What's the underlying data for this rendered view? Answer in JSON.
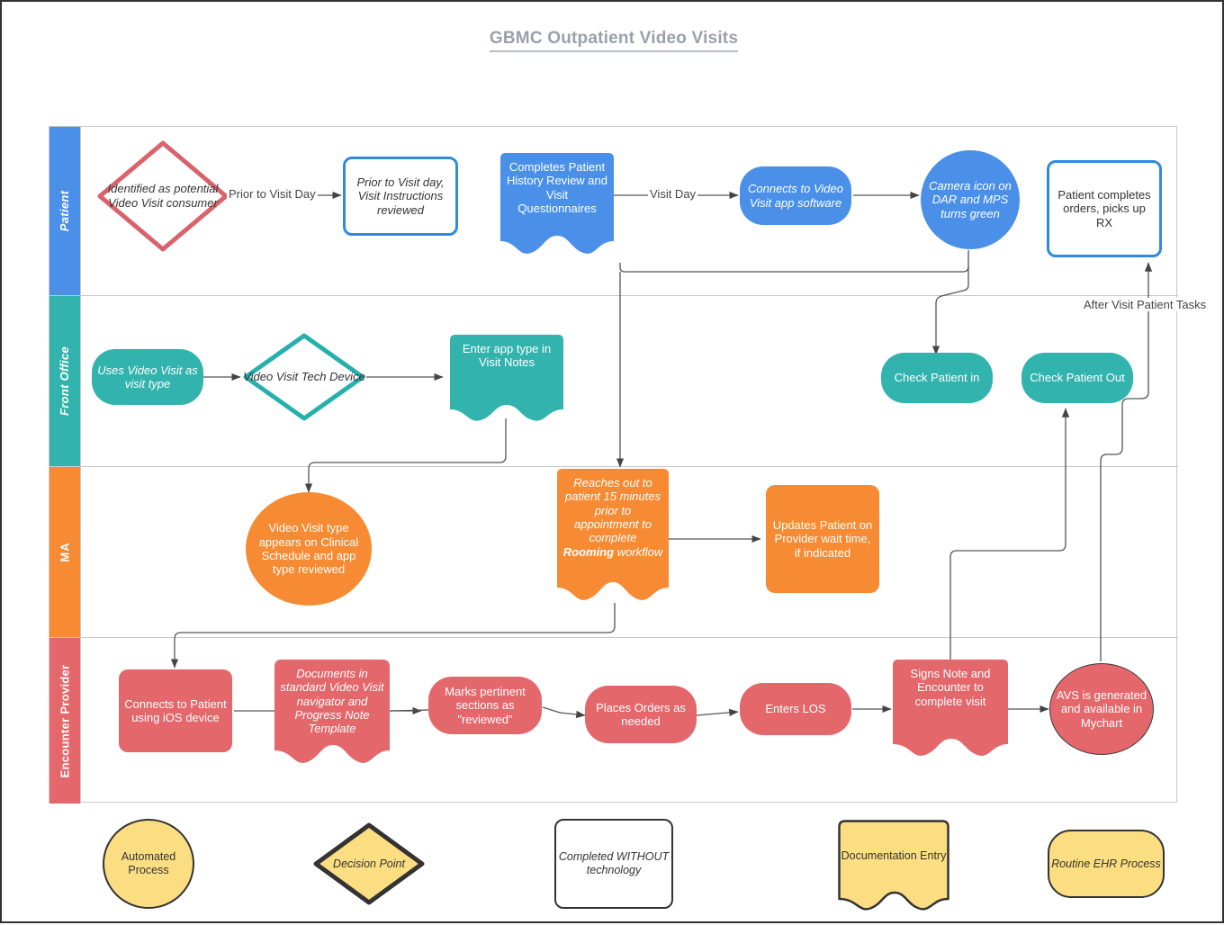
{
  "title": "GBMC Outpatient Video Visits",
  "lanes": [
    {
      "id": "patient",
      "label": "Patient",
      "color": "#4a90e8"
    },
    {
      "id": "front_office",
      "label": "Front Office",
      "color": "#32b3ad"
    },
    {
      "id": "ma",
      "label": "MA",
      "color": "#f68b33"
    },
    {
      "id": "provider",
      "label": "Encounter Provider",
      "color": "#e4676b"
    }
  ],
  "nodes": {
    "patient": [
      {
        "id": "identified",
        "text": "Identified as potential Video Visit consumer",
        "shape": "decision",
        "style": "outline",
        "color": "#d9636b"
      },
      {
        "id": "instructions",
        "text": "Prior to Visit day, Visit Instructions reviewed",
        "shape": "rounded-rect",
        "style": "outline",
        "color": "#2f8ae0"
      },
      {
        "id": "completes_history",
        "text": "Completes Patient History Review and Visit Questionnaires",
        "shape": "document",
        "style": "filled",
        "color": "#4a90e8"
      },
      {
        "id": "connects_app",
        "text": "Connects to Video Visit app software",
        "shape": "pill",
        "style": "filled",
        "color": "#4a90e8"
      },
      {
        "id": "camera_icon",
        "text": "Camera icon on DAR and MPS turns green",
        "shape": "ellipse",
        "style": "filled",
        "color": "#4a90e8"
      },
      {
        "id": "patient_completes_orders",
        "text": "Patient completes orders, picks up RX",
        "shape": "rounded-rect",
        "style": "outline",
        "color": "#2f8ae0"
      }
    ],
    "front_office": [
      {
        "id": "uses_video_visit",
        "text": "Uses Video Visit as visit type",
        "shape": "pill",
        "style": "filled",
        "color": "#32b3ad"
      },
      {
        "id": "tech_device",
        "text": "Video Visit Tech Device",
        "shape": "decision",
        "style": "outline",
        "color": "#26b0ad"
      },
      {
        "id": "enter_app_type",
        "text": "Enter app type in Visit Notes",
        "shape": "document",
        "style": "filled",
        "color": "#32b3ad"
      },
      {
        "id": "check_in",
        "text": "Check Patient in",
        "shape": "pill",
        "style": "filled",
        "color": "#32b3ad"
      },
      {
        "id": "check_out",
        "text": "Check Patient Out",
        "shape": "pill",
        "style": "filled",
        "color": "#32b3ad"
      }
    ],
    "ma": [
      {
        "id": "type_appears",
        "text": "Video Visit type appears on Clinical Schedule and app type reviewed",
        "shape": "ellipse",
        "style": "filled",
        "color": "#f68b33"
      },
      {
        "id": "reaches_out",
        "text": "Reaches out to patient 15 minutes prior to appointment to complete Rooming workflow",
        "bold_word": "Rooming",
        "shape": "document",
        "style": "filled",
        "color": "#f68b33"
      },
      {
        "id": "updates_wait",
        "text": "Updates Patient on Provider wait time, if indicated",
        "shape": "rounded-rect",
        "style": "filled",
        "color": "#f68b33"
      }
    ],
    "provider": [
      {
        "id": "connects_ios",
        "text": "Connects to Patient using iOS device",
        "shape": "rounded-rect",
        "style": "filled",
        "color": "#e4676b"
      },
      {
        "id": "documents_nav",
        "text": "Documents in standard Video Visit navigator and Progress Note Template",
        "shape": "document",
        "style": "filled",
        "color": "#e4676b"
      },
      {
        "id": "marks_reviewed",
        "text": "Marks pertinent sections as \"reviewed\"",
        "shape": "pill",
        "style": "filled",
        "color": "#e4676b"
      },
      {
        "id": "places_orders",
        "text": "Places Orders as needed",
        "shape": "pill",
        "style": "filled",
        "color": "#e4676b"
      },
      {
        "id": "enters_los",
        "text": "Enters LOS",
        "shape": "pill",
        "style": "filled",
        "color": "#e4676b"
      },
      {
        "id": "signs_note",
        "text": "Signs Note and Encounter to complete visit",
        "shape": "document",
        "style": "filled",
        "color": "#e4676b"
      },
      {
        "id": "avs",
        "text": "AVS is generated and available in Mychart",
        "shape": "ellipse",
        "style": "filled",
        "color": "#e4676b"
      }
    ]
  },
  "edge_labels": [
    {
      "id": "prior_to_visit_day",
      "text": "Prior to Visit Day"
    },
    {
      "id": "visit_day",
      "text": "Visit Day"
    },
    {
      "id": "after_visit_patient_tasks",
      "text": "After Visit Patient Tasks"
    }
  ],
  "legend": [
    {
      "id": "automated_process",
      "text": "Automated Process",
      "shape": "ellipse"
    },
    {
      "id": "decision_point",
      "text": "Decision Point",
      "shape": "diamond"
    },
    {
      "id": "completed_without_technology",
      "text": "Completed WITHOUT technology",
      "shape": "rounded-rect-white"
    },
    {
      "id": "documentation_entry",
      "text": "Documentation Entry",
      "shape": "document"
    },
    {
      "id": "routine_ehr_process",
      "text": "Routine  EHR Process",
      "shape": "pill"
    }
  ],
  "colors": {
    "patient": "#4a90e8",
    "front_office": "#32b3ad",
    "ma": "#f68b33",
    "provider": "#e4676b",
    "legend_yellow": "#FCDE82",
    "connector": "#555555",
    "frame": "#c8c8c8",
    "title": "#9aa0ac"
  }
}
